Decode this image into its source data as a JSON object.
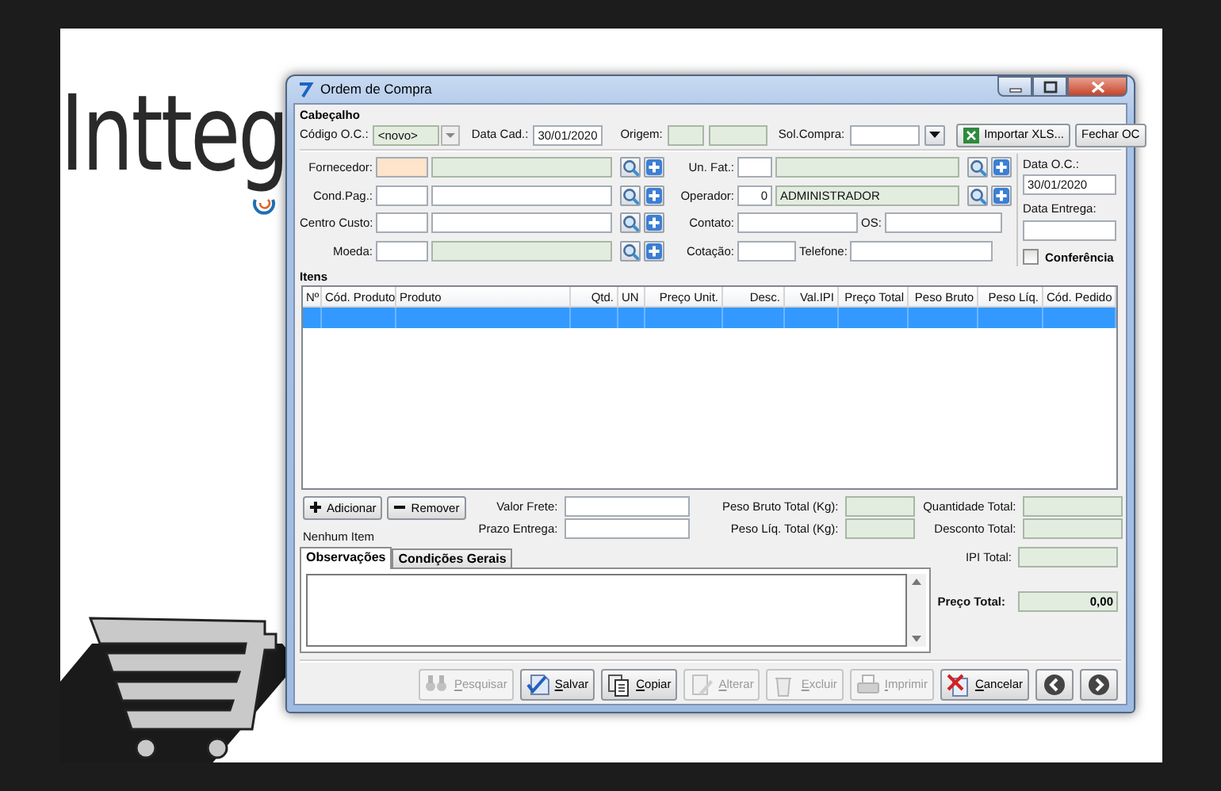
{
  "logo": {
    "text": "Intteg"
  },
  "window": {
    "title": "Ordem de Compra"
  },
  "header": {
    "section_title": "Cabeçalho",
    "codigo_oc": {
      "label": "Código O.C.:",
      "value": "<novo>"
    },
    "data_cad": {
      "label": "Data Cad.:",
      "value": "30/01/2020"
    },
    "origem": {
      "label": "Origem:"
    },
    "sol_compra": {
      "label": "Sol.Compra:"
    },
    "buttons": [
      {
        "label": "Importar XLS...",
        "kind": "import"
      },
      {
        "label": "Fechar OC",
        "kind": "plain"
      }
    ],
    "left_rows": [
      {
        "label": "Fornecedor:",
        "required": true,
        "readonly": true
      },
      {
        "label": "Cond.Pag.:",
        "required": false,
        "readonly": false
      },
      {
        "label": "Centro Custo:",
        "required": false,
        "readonly": false
      },
      {
        "label": "Moeda:",
        "required": false,
        "readonly": true
      }
    ],
    "middle_rows": [
      {
        "kind": "lookup",
        "label": "Un. Fat.:"
      },
      {
        "kind": "lookup",
        "label": "Operador:",
        "code": "0",
        "name": "ADMINISTRADOR"
      },
      {
        "kind": "pair",
        "label": "Contato:",
        "second_label": "OS:"
      },
      {
        "kind": "pair",
        "label": "Cotação:",
        "second_label": "Telefone:"
      }
    ],
    "data_oc": {
      "label": "Data O.C.:",
      "value": "30/01/2020"
    },
    "data_entrega": {
      "label": "Data Entrega:"
    },
    "conferencia": {
      "label": "Conferência",
      "checked": false
    }
  },
  "items": {
    "title": "Itens",
    "columns": [
      {
        "label": "Nº"
      },
      {
        "label": "Cód. Produto"
      },
      {
        "label": "Produto"
      },
      {
        "label": "Qtd."
      },
      {
        "label": "UN"
      },
      {
        "label": "Preço Unit."
      },
      {
        "label": "Desc."
      },
      {
        "label": "Val.IPI"
      },
      {
        "label": "Preço Total"
      },
      {
        "label": "Peso Bruto"
      },
      {
        "label": "Peso Líq."
      },
      {
        "label": "Cód. Pedido"
      }
    ],
    "rows": [
      {
        "selected": true
      }
    ],
    "buttons": [
      {
        "label": "Adicionar",
        "kind": "add"
      },
      {
        "label": "Remover",
        "kind": "remove"
      }
    ],
    "status": "Nenhum Item"
  },
  "totals": {
    "freight": [
      {
        "label": "Valor Frete:",
        "readonly": false
      },
      {
        "label": "Prazo Entrega:",
        "readonly": false
      }
    ],
    "weights": [
      {
        "label": "Peso Bruto Total (Kg):",
        "readonly": true
      },
      {
        "label": "Peso Líq. Total (Kg):",
        "readonly": true
      }
    ],
    "amounts": [
      {
        "label": "Quantidade Total:",
        "readonly": true
      },
      {
        "label": "Desconto Total:",
        "readonly": true
      },
      {
        "label": "IPI Total:",
        "readonly": true
      }
    ],
    "grand_total": {
      "label": "Preço Total:",
      "value": "0,00"
    }
  },
  "tabs": [
    {
      "label": "Observações",
      "selected": true
    },
    {
      "label": "Condições Gerais",
      "selected": false
    }
  ],
  "toolbar": [
    {
      "label": "Pesquisar",
      "kind": "search",
      "disabled": true
    },
    {
      "label": "Salvar",
      "kind": "save",
      "disabled": false
    },
    {
      "label": "Copiar",
      "kind": "copy",
      "disabled": false
    },
    {
      "label": "Alterar",
      "kind": "edit",
      "disabled": true
    },
    {
      "label": "Excluir",
      "kind": "delete",
      "disabled": true
    },
    {
      "label": "Imprimir",
      "kind": "print",
      "disabled": true
    },
    {
      "label": "Cancelar",
      "kind": "cancel",
      "disabled": false
    },
    {
      "kind": "previous",
      "disabled": false
    },
    {
      "kind": "next",
      "disabled": false
    }
  ]
}
